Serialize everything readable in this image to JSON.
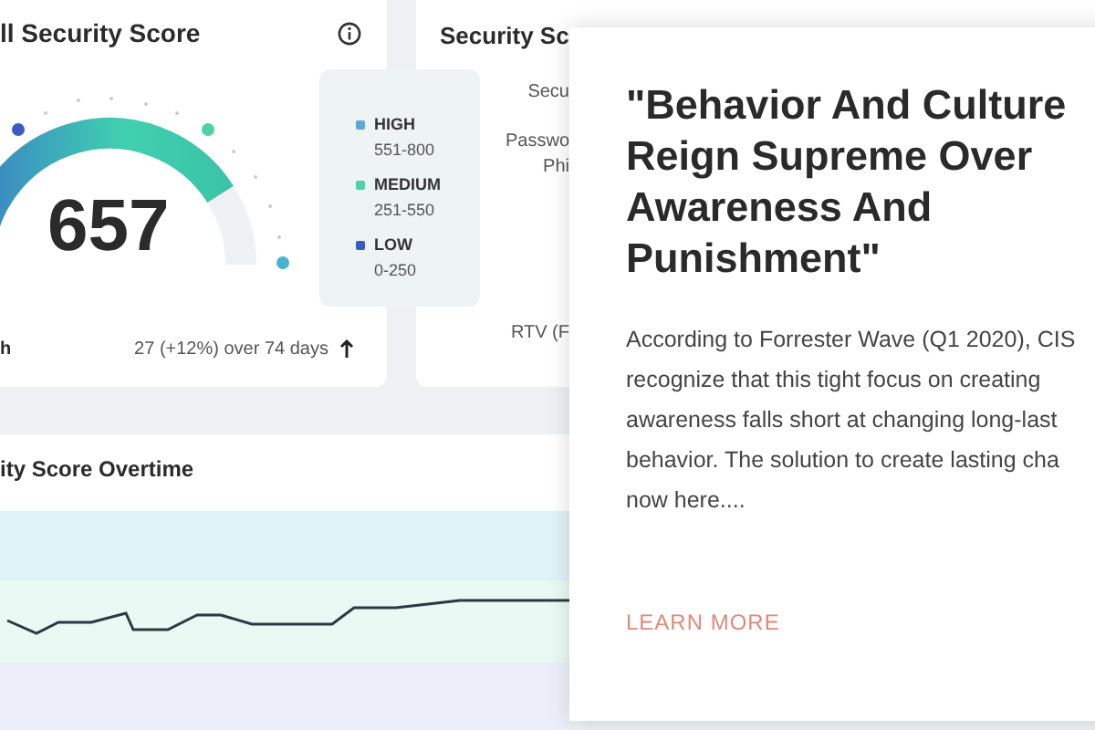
{
  "score_card": {
    "title": "ll Security Score",
    "score": "657",
    "footer_left": "h",
    "trend": "27 (+12%) over 74 days"
  },
  "legend": [
    {
      "label": "HIGH",
      "range": "551-800",
      "color": "#5aa9d6"
    },
    {
      "label": "MEDIUM",
      "range": "251-550",
      "color": "#4fd1a5"
    },
    {
      "label": "LOW",
      "range": "0-250",
      "color": "#3b5bc4"
    }
  ],
  "breakdown": {
    "title": "Security Sc",
    "labels": [
      "Secu",
      "Passwo",
      "Phi",
      "RTV (F"
    ]
  },
  "overtime": {
    "title": "ity Score Overtime"
  },
  "popup": {
    "title": "\"Behavior And Culture Reign Supreme Over Awareness And Punishment\"",
    "body_lines": [
      "According to Forrester Wave (Q1 2020), CIS",
      "recognize that this tight focus on creating",
      "awareness falls short at changing long-last",
      "behavior. The solution to create lasting cha",
      "now here...."
    ],
    "link": "LEARN MORE"
  }
}
